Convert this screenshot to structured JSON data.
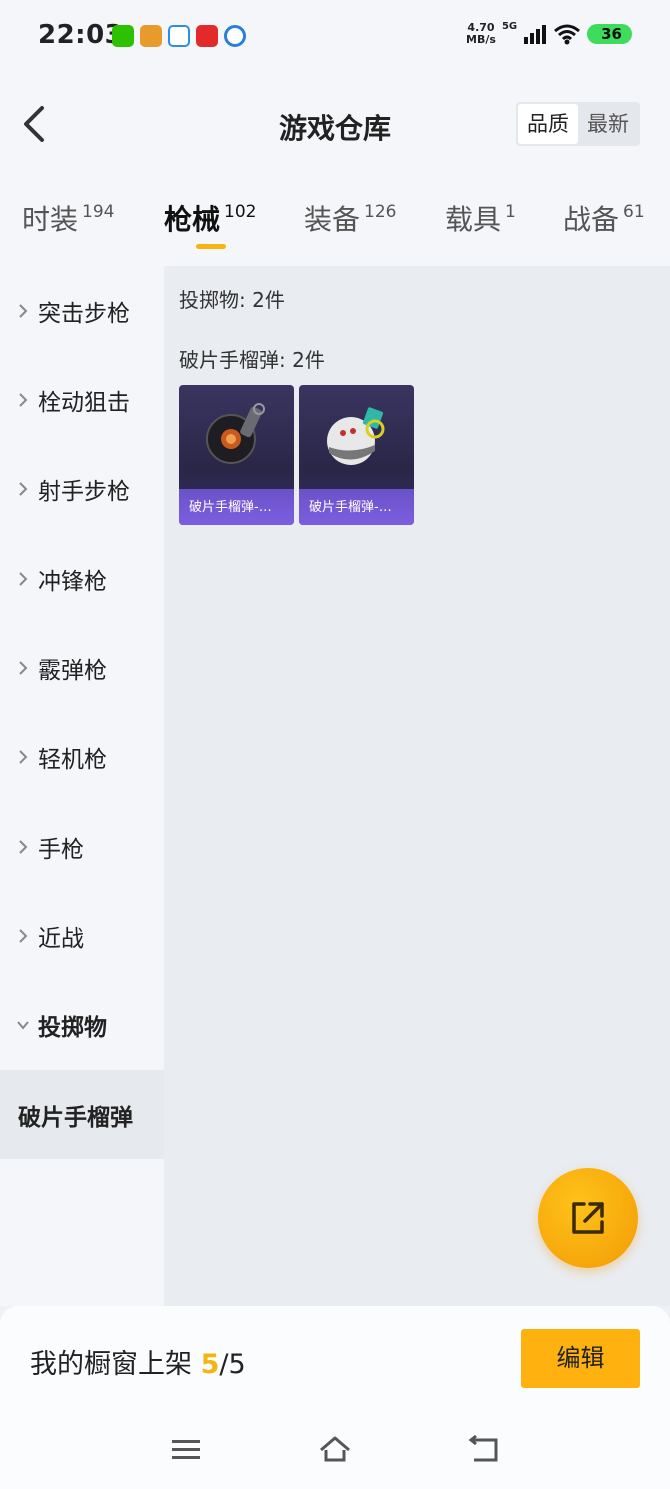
{
  "status_bar": {
    "time": "22:03",
    "speed_value": "4.70",
    "speed_unit": "MB/s",
    "network": "5G",
    "battery": "36"
  },
  "header": {
    "title": "游戏仓库",
    "sort_options": [
      "品质",
      "最新"
    ]
  },
  "tabs": [
    {
      "label": "时装",
      "count": "194"
    },
    {
      "label": "枪械",
      "count": "102"
    },
    {
      "label": "装备",
      "count": "126"
    },
    {
      "label": "载具",
      "count": "1"
    },
    {
      "label": "战备",
      "count": "61"
    }
  ],
  "sidebar": {
    "items": [
      {
        "label": "突击步枪"
      },
      {
        "label": "栓动狙击"
      },
      {
        "label": "射手步枪"
      },
      {
        "label": "冲锋枪"
      },
      {
        "label": "霰弹枪"
      },
      {
        "label": "轻机枪"
      },
      {
        "label": "手枪"
      },
      {
        "label": "近战"
      },
      {
        "label": "投掷物"
      }
    ],
    "sub_item": "破片手榴弹"
  },
  "content": {
    "category_summary": "投掷物: 2件",
    "group_title": "破片手榴弹: 2件",
    "cards": [
      {
        "label": "破片手榴弹-…"
      },
      {
        "label": "破片手榴弹-…"
      }
    ]
  },
  "bottom_bar": {
    "shelf_prefix": "我的橱窗上架",
    "shelf_current": "5",
    "shelf_total": "/5",
    "edit_label": "编辑"
  },
  "colors": {
    "accent": "#f5b40f",
    "card_label": "#7259d6",
    "card_bg": "#2e2a50"
  }
}
